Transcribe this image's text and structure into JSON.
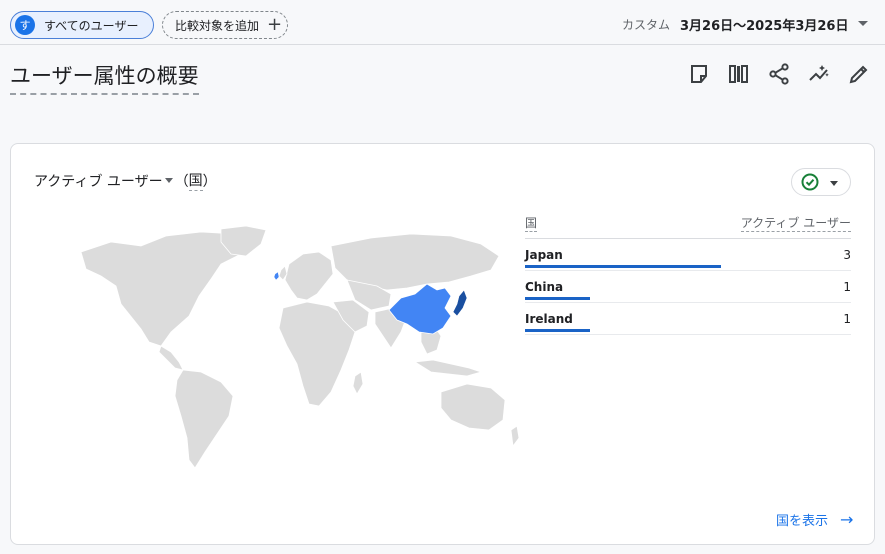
{
  "topbar": {
    "segment_badge": "す",
    "segment_label": "すべてのユーザー",
    "compare_label": "比較対象を追加",
    "compare_plus": "+",
    "date_preset": "カスタム",
    "date_range": "3月26日～2025年3月26日"
  },
  "page": {
    "title": "ユーザー属性の概要"
  },
  "toolbar": {
    "icons": [
      "note-icon",
      "compare-columns-icon",
      "share-icon",
      "insights-icon",
      "edit-icon"
    ]
  },
  "card": {
    "metric_label": "アクティブ ユーザー",
    "dimension_open": "（",
    "dimension_label": "国",
    "dimension_close": "）",
    "table": {
      "col_dimension": "国",
      "col_metric": "アクティブ ユーザー",
      "rows": [
        {
          "country": "Japan",
          "value": "3",
          "share": 1.0
        },
        {
          "country": "China",
          "value": "1",
          "share": 0.333
        },
        {
          "country": "Ireland",
          "value": "1",
          "share": 0.333
        }
      ]
    },
    "view_link": "国を表示",
    "view_arrow": "→"
  },
  "colors": {
    "accent": "#1a73e8",
    "map_highlight": "#4285f4",
    "map_strong": "#1a4fa0",
    "map_base": "#dcdcdc",
    "status_ok": "#188038"
  }
}
